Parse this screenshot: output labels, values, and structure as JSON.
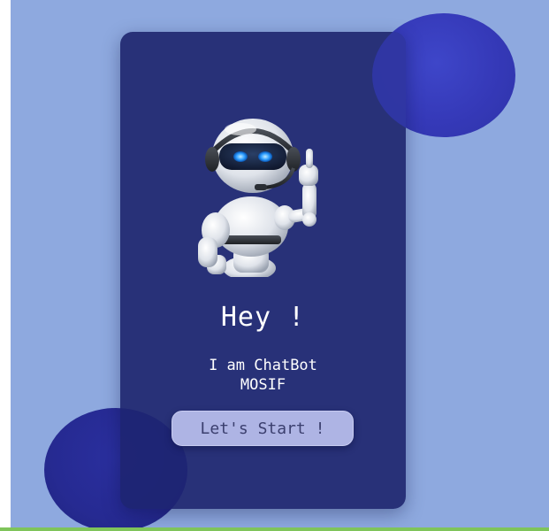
{
  "welcome": {
    "greeting": "Hey !",
    "intro_line1": "I am ChatBot",
    "intro_line2": "MOSIF",
    "start_button": "Let's Start !"
  },
  "colors": {
    "background": "#8ea9df",
    "card": "#202870",
    "accent_blob": "#3e46c9",
    "button": "#aeb4e4",
    "bottom_bar": "#7fc45a"
  },
  "icons": {
    "robot": "robot-mascot-icon"
  }
}
